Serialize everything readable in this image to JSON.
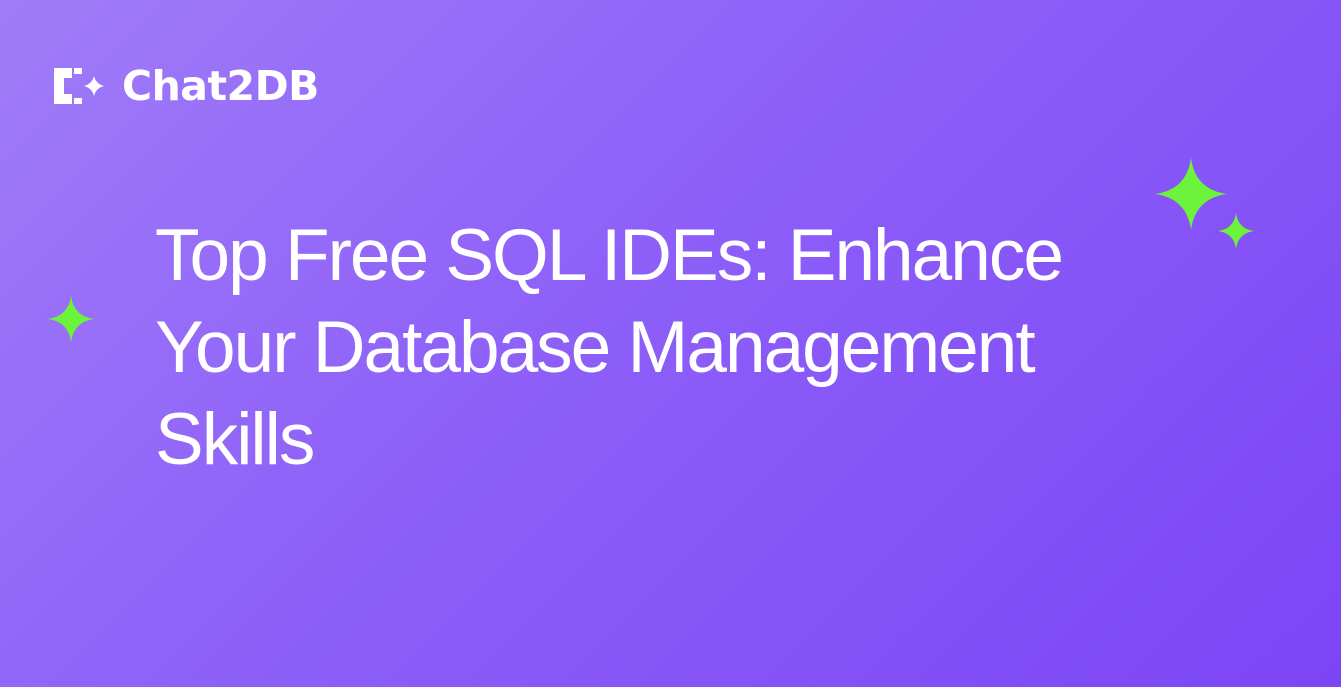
{
  "brand": {
    "name": "Chat2DB",
    "logo_icon": "chat2db-logo-icon"
  },
  "headline": {
    "lines": [
      "Top Free SQL IDEs: Enhance",
      "Your Database Management",
      "Skills"
    ]
  },
  "decorations": {
    "icon": "sparkle-icon",
    "color": "#6cf33c"
  },
  "colors": {
    "background_start": "#a07cf8",
    "background_end": "#7c45f6",
    "text": "#ffffff"
  }
}
